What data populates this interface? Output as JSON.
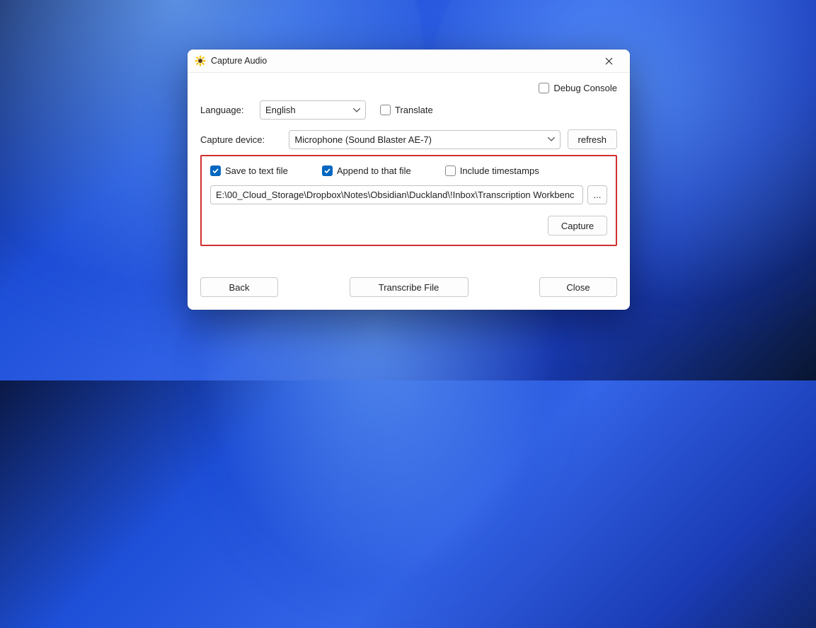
{
  "window": {
    "title": "Capture Audio"
  },
  "debug": {
    "label": "Debug Console",
    "checked": false
  },
  "language": {
    "label": "Language:",
    "selected": "English"
  },
  "translate": {
    "label": "Translate",
    "checked": false
  },
  "device": {
    "label": "Capture device:",
    "selected": "Microphone (Sound Blaster AE-7)",
    "refresh_label": "refresh"
  },
  "saveOptions": {
    "save_to_file": {
      "label": "Save to text file",
      "checked": true
    },
    "append": {
      "label": "Append to that file",
      "checked": true
    },
    "timestamps": {
      "label": "Include timestamps",
      "checked": false
    },
    "path": "E:\\00_Cloud_Storage\\Dropbox\\Notes\\Obsidian\\Duckland\\!Inbox\\Transcription Workbenc",
    "browse_label": "...",
    "capture_label": "Capture"
  },
  "footer": {
    "back": "Back",
    "transcribe": "Transcribe File",
    "close": "Close"
  }
}
